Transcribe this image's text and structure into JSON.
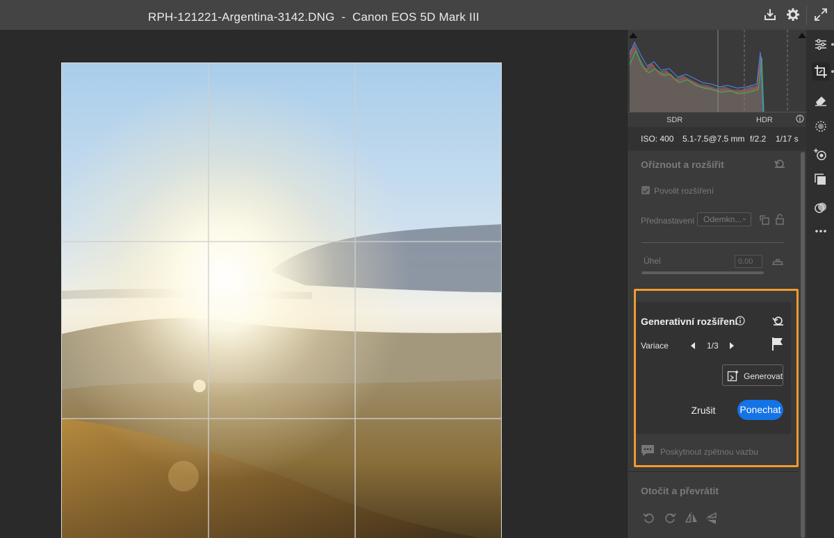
{
  "window": {
    "title": "RPH-121221-Argentina-3142.DNG  -  Canon EOS 5D Mark III"
  },
  "toolbar": {
    "icons": [
      "export-icon",
      "gear-icon",
      "fullscreen-icon"
    ]
  },
  "histogram": {
    "sdr_label": "SDR",
    "hdr_label": "HDR",
    "info_icon": "info-icon"
  },
  "exif": {
    "iso": "ISO: 400",
    "lens": "5.1-7.5@7.5 mm",
    "aperture": "f/2.2",
    "shutter": "1/17 s"
  },
  "crop_section": {
    "title": "Oříznout a rozšířit",
    "allow_expand_label": "Povolit rozšíření",
    "preset_label": "Přednastavení",
    "preset_value": "Odemkn...",
    "angle_label": "Úhel",
    "angle_value": "0.00"
  },
  "generative_expand": {
    "title": "Generativní rozšíření",
    "variations_label": "Variace",
    "variation_count": "1/3",
    "generate_label": "Generovat",
    "cancel_label": "Zrušit",
    "keep_label": "Ponechat",
    "feedback_label": "Poskytnout zpětnou vazbu"
  },
  "rotate_section": {
    "title": "Otočit a převrátit"
  },
  "colors": {
    "accent_blue": "#1473e6",
    "highlight_orange": "#f29a2e"
  }
}
